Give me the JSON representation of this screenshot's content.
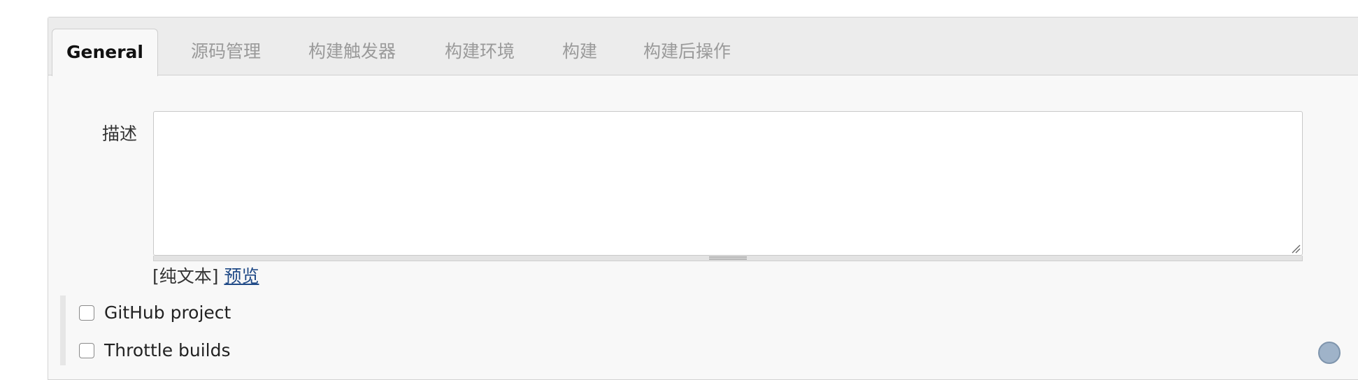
{
  "tabs": [
    {
      "label": "General",
      "active": true
    },
    {
      "label": "源码管理",
      "active": false
    },
    {
      "label": "构建触发器",
      "active": false
    },
    {
      "label": "构建环境",
      "active": false
    },
    {
      "label": "构建",
      "active": false
    },
    {
      "label": "构建后操作",
      "active": false
    }
  ],
  "description": {
    "label": "描述",
    "value": "",
    "format_text": "[纯文本]",
    "preview_link": "预览"
  },
  "options": [
    {
      "label": "GitHub project",
      "checked": false
    },
    {
      "label": "Throttle builds",
      "checked": false
    }
  ],
  "icons": {
    "help": "help-icon",
    "resize": "resize-grip-icon"
  },
  "colors": {
    "link": "#204a87",
    "tab_inactive": "#9a9a9a",
    "panel_bg": "#f8f8f8"
  }
}
